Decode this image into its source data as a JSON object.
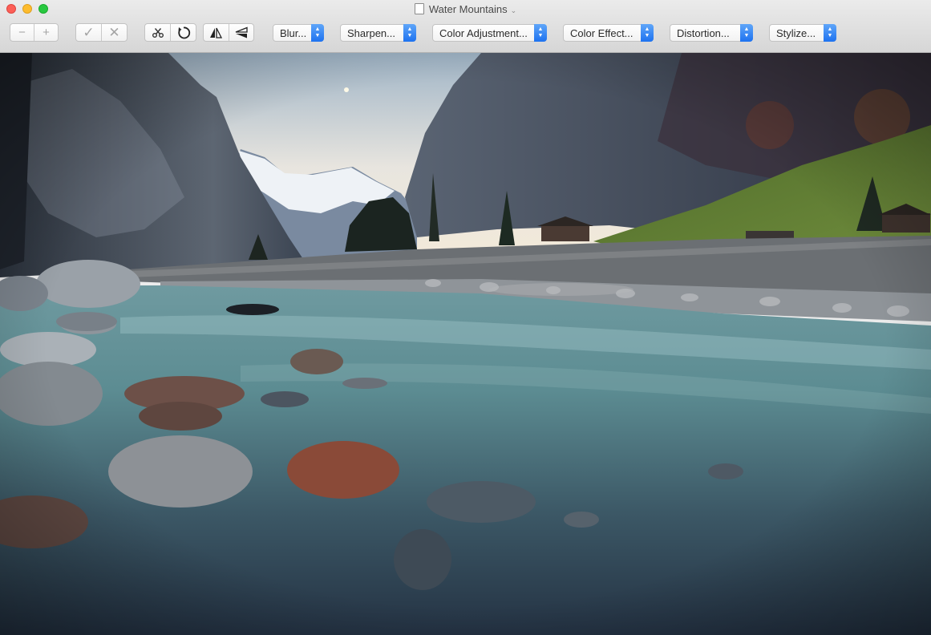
{
  "window": {
    "title": "Water Mountains"
  },
  "toolbar": {
    "zoom_out": "−",
    "zoom_in": "+",
    "apply": "✓",
    "cancel": "✕",
    "filters": [
      {
        "label": "Blur..."
      },
      {
        "label": "Sharpen..."
      },
      {
        "label": "Color Adjustment..."
      },
      {
        "label": "Color Effect..."
      },
      {
        "label": "Distortion..."
      },
      {
        "label": "Stylize..."
      }
    ],
    "icons": {
      "crop": "scissors-icon",
      "rotate": "rotate-icon",
      "flip_h": "flip-horizontal-icon",
      "flip_v": "flip-vertical-icon",
      "popup_arrows": "updown-chevron-icon"
    }
  },
  "image": {
    "subject": "river-valley-mountains-photo"
  },
  "colors": {
    "accent": "#1d72f0",
    "close": "#fc5f57",
    "minimize": "#fdbc2e",
    "zoom": "#28c840"
  }
}
